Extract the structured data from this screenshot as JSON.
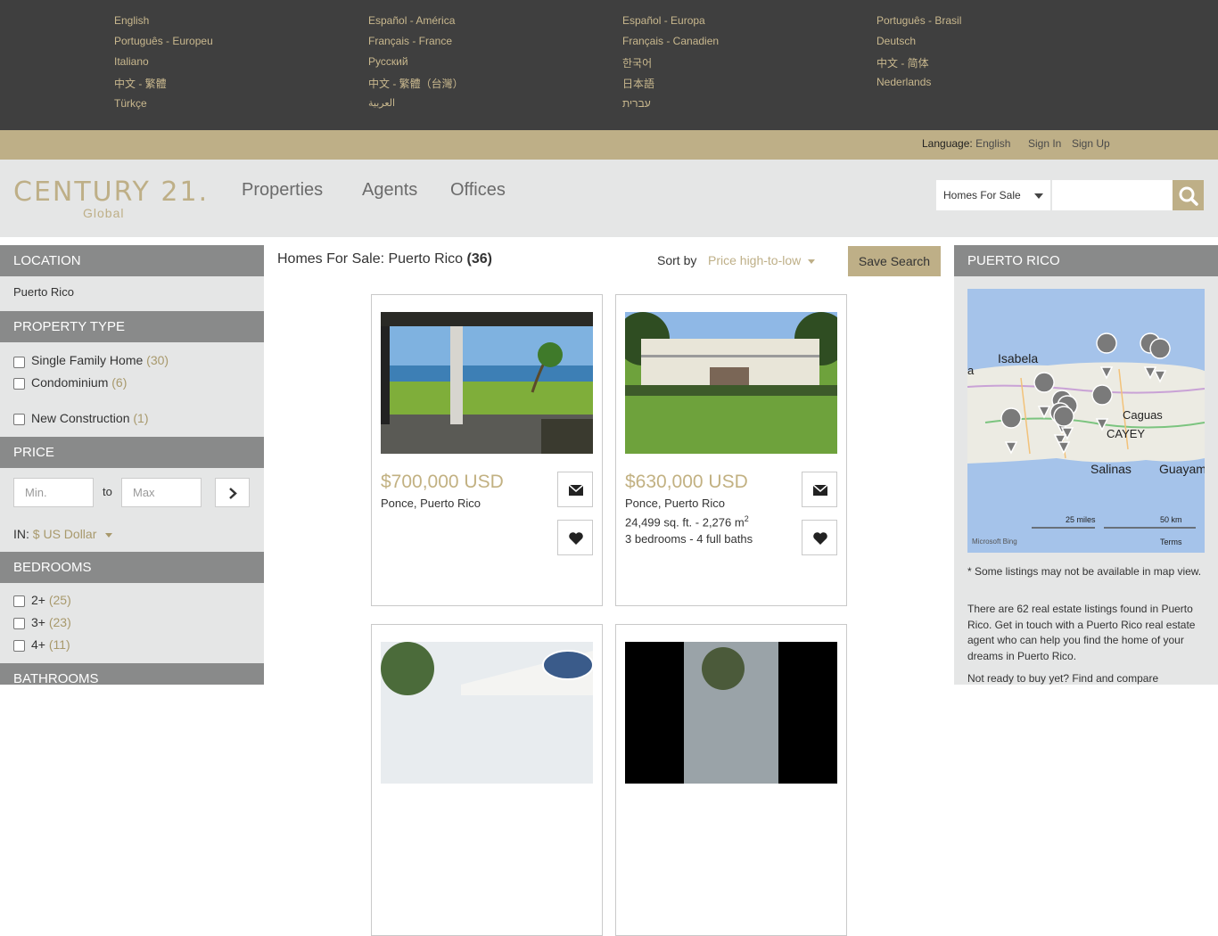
{
  "languages": [
    [
      "English",
      "Español - América",
      "Español - Europa",
      "Português - Brasil"
    ],
    [
      "Português - Europeu",
      "Français - France",
      "Français - Canadien",
      "Deutsch"
    ],
    [
      "Italiano",
      "Русский",
      "한국어",
      "中文 - 简体"
    ],
    [
      "中文 - 繁體",
      "中文 - 繁體（台灣）",
      "日本語",
      "Nederlands"
    ],
    [
      "Türkçe",
      "العربية",
      "עברית",
      ""
    ]
  ],
  "utility": {
    "language_label": "Language:",
    "language_value": "English",
    "sign_in": "Sign In",
    "sign_up": "Sign Up"
  },
  "header": {
    "logo_main": "CENTURY 21.",
    "logo_sub": "Global",
    "nav": [
      "Properties",
      "Agents",
      "Offices"
    ],
    "search_type": "Homes For Sale",
    "search_placeholder": ""
  },
  "sidebar": {
    "location_head": "LOCATION",
    "location_value": "Puerto Rico",
    "type_head": "PROPERTY TYPE",
    "types": [
      {
        "label": "Single Family Home",
        "count": "(30)"
      },
      {
        "label": "Condominium",
        "count": "(6)"
      },
      {
        "label": "New Construction",
        "count": "(1)"
      }
    ],
    "price_head": "PRICE",
    "min_placeholder": "Min.",
    "to": "to",
    "max_placeholder": "Max",
    "currency_label": "IN:",
    "currency_value": "$ US Dollar",
    "bedrooms_head": "BEDROOMS",
    "bedrooms": [
      {
        "label": "2+",
        "count": "(25)"
      },
      {
        "label": "3+",
        "count": "(23)"
      },
      {
        "label": "4+",
        "count": "(11)"
      }
    ],
    "bathrooms_head": "BATHROOMS"
  },
  "results": {
    "title_prefix": "Homes For Sale: Puerto Rico",
    "count": "(36)",
    "sort_label": "Sort by",
    "sort_value": "Price high-to-low",
    "save_search": "Save Search",
    "listings": [
      {
        "price": "$700,000 USD",
        "location": "Ponce, Puerto Rico",
        "area": "",
        "area_unit": "",
        "beds_baths": ""
      },
      {
        "price": "$630,000 USD",
        "location": "Ponce, Puerto Rico",
        "area": "24,499 sq. ft. - 2,276 m",
        "area_unit": "2",
        "beds_baths": "3 bedrooms - 4 full baths"
      }
    ]
  },
  "right": {
    "head": "PUERTO RICO",
    "map_labels": {
      "isabela": "Isabela",
      "caguas": "Caguas",
      "cayey": "CAYEY",
      "salinas": "Salinas",
      "guayama": "Guayama",
      "a": "a",
      "miles": "25 miles",
      "km": "50 km",
      "bing": "Microsoft Bing",
      "terms": "Terms"
    },
    "note": "* Some listings may not be available in map view.",
    "para1": "There are 62 real estate listings found in Puerto Rico. Get in touch with a Puerto Rico real estate agent who can help you find the home of your dreams in Puerto Rico.",
    "para2": "Not ready to buy yet? Find and compare"
  },
  "colors": {
    "gold": "#beaf87",
    "dark": "#3f3f3f",
    "gray_head": "#898a8a",
    "panel": "#e5e6e6"
  }
}
